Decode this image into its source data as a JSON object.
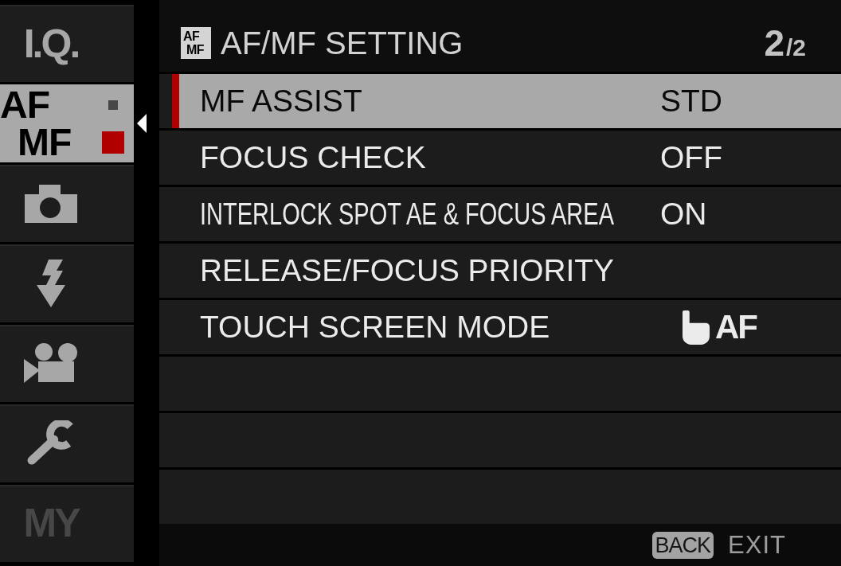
{
  "sidebar": {
    "tabs": [
      {
        "kind": "text",
        "label": "I.Q.",
        "selected": false,
        "disabled": false
      },
      {
        "kind": "stacked",
        "lines": [
          "AF",
          "MF"
        ],
        "page_markers": [
          {
            "selected": false
          },
          {
            "selected": true
          }
        ],
        "selected": true,
        "disabled": false
      },
      {
        "kind": "camera",
        "selected": false,
        "disabled": false
      },
      {
        "kind": "flash",
        "selected": false,
        "disabled": false
      },
      {
        "kind": "movie",
        "selected": false,
        "disabled": false
      },
      {
        "kind": "wrench",
        "selected": false,
        "disabled": false
      },
      {
        "kind": "text",
        "label": "MY",
        "selected": false,
        "disabled": true
      }
    ]
  },
  "header": {
    "badge_lines": [
      "AF",
      "MF"
    ],
    "title": "AF/MF SETTING",
    "page_number": "2",
    "page_total": "/2"
  },
  "rows": [
    {
      "kind": "setting",
      "label": "MF ASSIST",
      "value": "STD",
      "selected": true
    },
    {
      "kind": "setting",
      "label": "FOCUS CHECK",
      "value": "OFF",
      "selected": false
    },
    {
      "kind": "setting",
      "label": "INTERLOCK SPOT AE & FOCUS AREA",
      "value": "ON",
      "selected": false
    },
    {
      "kind": "setting",
      "label": "RELEASE/FOCUS PRIORITY",
      "selected": false
    },
    {
      "kind": "setting-icon",
      "label": "TOUCH SCREEN MODE",
      "value": "AF",
      "selected": false
    },
    {
      "kind": "blank",
      "selected": false
    },
    {
      "kind": "blank",
      "selected": false
    },
    {
      "kind": "blank",
      "selected": false
    }
  ],
  "footer": {
    "key": "BACK",
    "action": "EXIT"
  }
}
